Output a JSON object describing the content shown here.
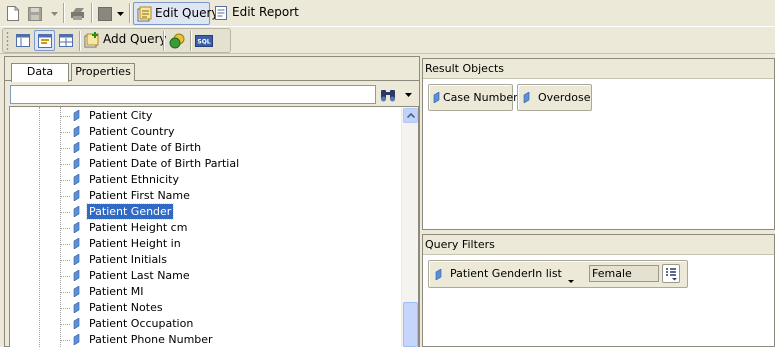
{
  "toolbar": {
    "edit_query_label": "Edit Query",
    "edit_report_label": "Edit Report",
    "add_query_label": "Add Query",
    "sql_label": "SQL"
  },
  "left_panel": {
    "tabs": [
      "Data",
      "Properties"
    ],
    "active_tab": "Data",
    "search": {
      "value": "",
      "placeholder": ""
    },
    "tree_items": [
      "Patient City",
      "Patient Country",
      "Patient Date of Birth",
      "Patient Date of Birth Partial",
      "Patient Ethnicity",
      "Patient First Name",
      "Patient Gender",
      "Patient Height cm",
      "Patient Height in",
      "Patient Initials",
      "Patient Last Name",
      "Patient MI",
      "Patient Notes",
      "Patient Occupation",
      "Patient Phone Number"
    ],
    "selected_item": "Patient Gender"
  },
  "result_objects": {
    "title": "Result Objects",
    "items": [
      "Case Number",
      "Overdose"
    ]
  },
  "query_filters": {
    "title": "Query Filters",
    "filter": {
      "field": "Patient Gender",
      "operator": "In list",
      "value": "Female"
    }
  },
  "colors": {
    "selection": "#316ac5",
    "toolbar_bg": "#ece9d8",
    "dimension_icon": "#5b8fd6"
  }
}
